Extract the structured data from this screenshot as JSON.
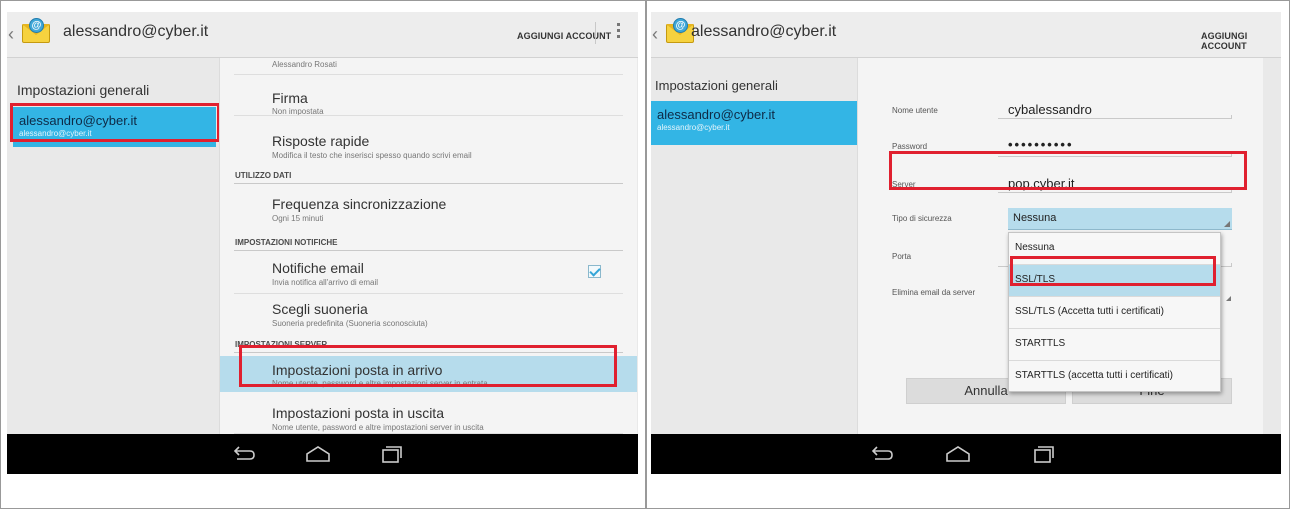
{
  "left_screen": {
    "actionbar": {
      "account": "alessandro@cyber.it",
      "add_account": "AGGIUNGI ACCOUNT"
    },
    "sidebar": {
      "general": "Impostazioni generali",
      "account_name": "alessandro@cyber.it",
      "account_email": "alessandro@cyber.it"
    },
    "settings": {
      "top_partial": "Alessandro Rosati",
      "signature_title": "Firma",
      "signature_sub": "Non impostata",
      "quick_title": "Risposte rapide",
      "quick_sub": "Modifica il testo che inserisci spesso quando scrivi email",
      "cat_data": "UTILIZZO DATI",
      "sync_title": "Frequenza sincronizzazione",
      "sync_sub": "Ogni 15 minuti",
      "cat_notif": "IMPOSTAZIONI NOTIFICHE",
      "notif_title": "Notifiche email",
      "notif_sub": "Invia notifica all'arrivo di email",
      "ring_title": "Scegli suoneria",
      "ring_sub": "Suoneria predefinita (Suoneria sconosciuta)",
      "cat_server": "IMPOSTAZIONI SERVER",
      "incoming_title": "Impostazioni posta in arrivo",
      "incoming_sub": "Nome utente, password e altre impostazioni server in entrata",
      "outgoing_title": "Impostazioni posta in uscita",
      "outgoing_sub": "Nome utente, password e altre impostazioni server in uscita"
    }
  },
  "right_screen": {
    "actionbar": {
      "account": "alessandro@cyber.it",
      "add_account": "AGGIUNGI ACCOUNT"
    },
    "sidebar": {
      "general": "Impostazioni generali",
      "account_name": "alessandro@cyber.it",
      "account_email": "alessandro@cyber.it"
    },
    "form": {
      "username_label": "Nome utente",
      "username_value": "cybalessandro",
      "password_label": "Password",
      "password_value": "••••••••••",
      "server_label": "Server",
      "server_value": "pop.cyber.it",
      "security_label": "Tipo di sicurezza",
      "security_value": "Nessuna",
      "port_label": "Porta",
      "delete_label": "Elimina email da server",
      "cancel_button": "Annulla",
      "done_button": "Fine"
    },
    "dropdown": {
      "options": [
        "Nessuna",
        "SSL/TLS",
        "SSL/TLS (Accetta tutti i certificati)",
        "STARTTLS",
        "STARTTLS (accetta tutti i certificati)"
      ]
    }
  },
  "colors": {
    "highlight": "#e0202f",
    "selected": "#b6dcec",
    "holo_blue": "#33b5e5"
  }
}
